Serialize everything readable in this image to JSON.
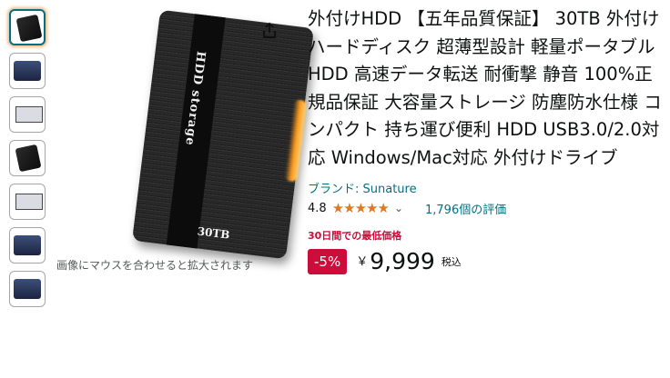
{
  "thumbnails": [
    {
      "name": "thumb-1",
      "selected": true
    },
    {
      "name": "thumb-2",
      "selected": false
    },
    {
      "name": "thumb-3",
      "selected": false
    },
    {
      "name": "thumb-4",
      "selected": false
    },
    {
      "name": "thumb-5",
      "selected": false
    },
    {
      "name": "thumb-6",
      "selected": false
    },
    {
      "name": "thumb-7",
      "selected": false
    }
  ],
  "gallery": {
    "hint": "画像にマウスを合わせると拡大されます",
    "drive_label": "HDD storage",
    "drive_capacity": "30TB",
    "share_icon": "share-icon"
  },
  "product": {
    "title": "外付けHDD 【五年品質保証】 30TB 外付けハードディスク 超薄型設計 軽量ポータブルHDD 高速データ転送 耐衝撃 静音 100%正規品保証 大容量ストレージ 防塵防水仕様 コンパクト 持ち運び便利 HDD USB3.0/2.0対応 Windows/Mac対応 外付けドライブ",
    "brand": "ブランド: Sunature",
    "rating": "4.8",
    "stars": "★★★★★",
    "ratings_count": "1,796個の評価",
    "deal_badge": "30日間での最低価格",
    "discount": "-5%",
    "currency": "￥",
    "price": "9,999",
    "tax_note": "税込"
  },
  "colors": {
    "link": "#007185",
    "deal": "#cc0c39",
    "star": "#de7921"
  }
}
